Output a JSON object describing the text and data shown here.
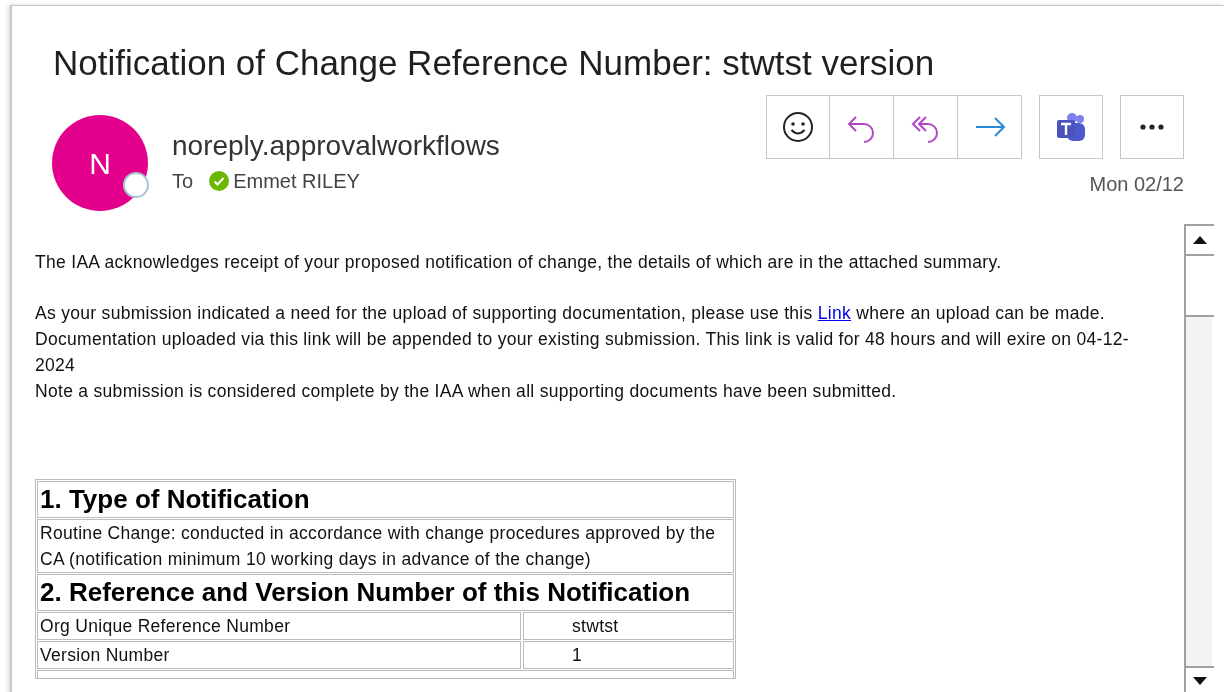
{
  "subject": "Notification of Change Reference Number: stwtst version",
  "sender": {
    "initial": "N",
    "name": "noreply.approvalworkflows",
    "to_label": "To",
    "recipient": "Emmet RILEY",
    "date": "Mon 02/12"
  },
  "actions": [
    {
      "kind": "emoji"
    },
    {
      "kind": "reply"
    },
    {
      "kind": "reply-all"
    },
    {
      "kind": "forward"
    },
    {
      "kind": "teams"
    },
    {
      "kind": "more"
    }
  ],
  "body": {
    "intro": "The IAA acknowledges receipt of your proposed notification of change, the details of which are in the attached summary.",
    "upload": {
      "before": "As your submission indicated a need for the upload of supporting documentation, please use this",
      "link": "Link",
      "after": "where an upload can be made."
    },
    "validity": "Documentation uploaded via this link will be appended to your existing submission. This link is valid for 48 hours and will exire on 04-12-2024",
    "note": "Note a submission is considered complete by the IAA when all supporting documents have been submitted."
  },
  "table": [
    {
      "kind": "heading",
      "text": "1. Type of Notification"
    },
    {
      "kind": "text",
      "text": "Routine Change: conducted in accordance with change procedures approved by the CA (notification minimum 10 working days in advance of the change)"
    },
    {
      "kind": "heading",
      "text": "2. Reference and Version Number of this Notification"
    },
    {
      "kind": "pair",
      "label": "Org Unique Reference Number",
      "value": "stwtst"
    },
    {
      "kind": "pair",
      "label": "Version Number",
      "value": "1"
    },
    {
      "kind": "cut"
    }
  ]
}
